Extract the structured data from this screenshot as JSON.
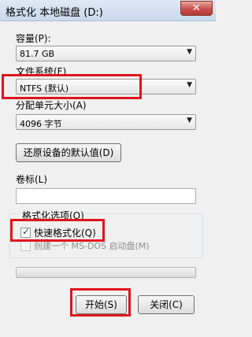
{
  "window": {
    "title": "格式化 本地磁盘 (D:)",
    "close_glyph": "✕"
  },
  "capacity": {
    "label": "容量(P):",
    "value": "81.7 GB"
  },
  "filesystem": {
    "label": "文件系统(F)",
    "value": "NTFS (默认)"
  },
  "alloc": {
    "label": "分配单元大小(A)",
    "value": "4096 字节"
  },
  "restore_button": "还原设备的默认值(D)",
  "volume": {
    "label": "卷标(L)",
    "value": ""
  },
  "options": {
    "title": "格式化选项(O)",
    "quick_format": {
      "label": "快速格式化(Q)",
      "checked": true
    },
    "msdos_disk": {
      "label": "创建一个 MS-DOS 启动盘(M)",
      "checked": false
    }
  },
  "progress": {
    "fraction": 0
  },
  "buttons": {
    "start": "开始(S)",
    "close": "关闭(C)"
  },
  "colors": {
    "highlight_box": "#e0141c",
    "progress_fill": "#37b23a"
  }
}
